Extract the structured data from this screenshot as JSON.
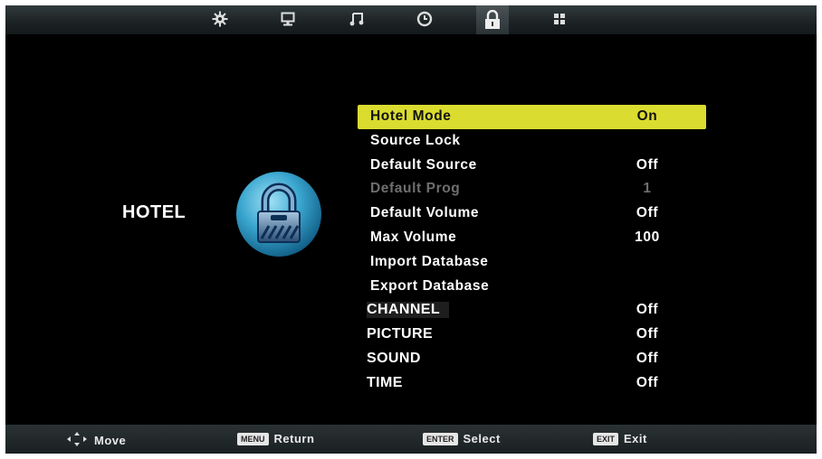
{
  "top_bar": {
    "icons": [
      "settings-icon",
      "picture-icon",
      "sound-icon",
      "time-icon",
      "lock-icon",
      "apps-icon"
    ],
    "active_icon": "lock-icon"
  },
  "category": {
    "label": "HOTEL",
    "icon": "padlock-globe-icon"
  },
  "menu": {
    "rows": [
      {
        "label": "Hotel Mode",
        "value": "On",
        "state": "selected"
      },
      {
        "label": "Source Lock",
        "value": ""
      },
      {
        "label": "Default Source",
        "value": "Off"
      },
      {
        "label": "Default Prog",
        "value": "1",
        "state": "disabled"
      },
      {
        "label": "Default Volume",
        "value": "Off"
      },
      {
        "label": "Max Volume",
        "value": "100"
      },
      {
        "label": "Import Database",
        "value": ""
      },
      {
        "label": "Export Database",
        "value": ""
      },
      {
        "label": "CHANNEL",
        "value": "Off"
      },
      {
        "label": "PICTURE",
        "value": "Off"
      },
      {
        "label": "SOUND",
        "value": "Off"
      },
      {
        "label": "TIME",
        "value": "Off"
      }
    ]
  },
  "bottom_bar": {
    "move_label": "Move",
    "menu_key": "MENU",
    "return_label": "Return",
    "enter_key": "ENTER",
    "select_label": "Select",
    "exit_key": "EXIT",
    "exit_label": "Exit"
  },
  "colors": {
    "highlight": "#dadc2f",
    "background": "#000000",
    "disabled_text": "#6e6e6e"
  }
}
